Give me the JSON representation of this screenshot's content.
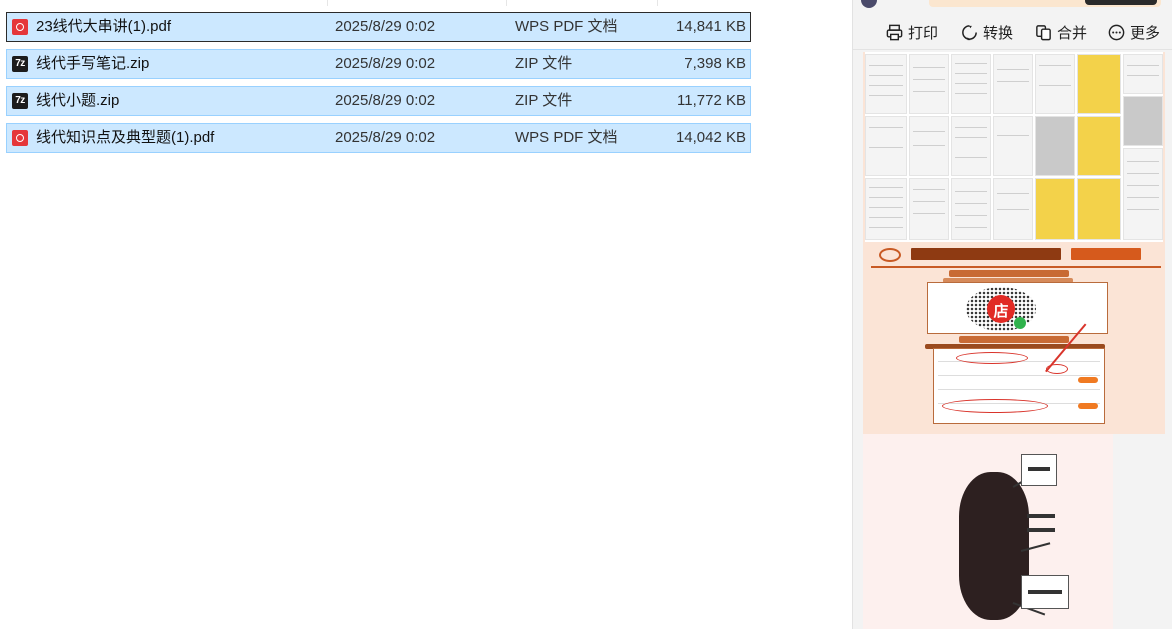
{
  "files": [
    {
      "name": "23线代大串讲(1).pdf",
      "date": "2025/8/29 0:02",
      "type": "WPS PDF 文档",
      "size": "14,841 KB",
      "icon": "pdf-file-icon",
      "focused": true
    },
    {
      "name": "线代手写笔记.zip",
      "date": "2025/8/29 0:02",
      "type": "ZIP 文件",
      "size": "7,398 KB",
      "icon": "7z-archive-icon",
      "focused": false
    },
    {
      "name": "线代小题.zip",
      "date": "2025/8/29 0:02",
      "type": "ZIP 文件",
      "size": "11,772 KB",
      "icon": "7z-archive-icon",
      "focused": false
    },
    {
      "name": "线代知识点及典型题(1).pdf",
      "date": "2025/8/29 0:02",
      "type": "WPS PDF 文档",
      "size": "14,042 KB",
      "icon": "pdf-file-icon",
      "focused": false
    }
  ],
  "zip_icon_text": "7z",
  "preview": {
    "toolbar": {
      "print": "打印",
      "convert": "转换",
      "merge": "合并",
      "more": "更多"
    },
    "qr_badge": "店"
  },
  "colors": {
    "selection_bg": "#cce8ff",
    "selection_border": "#99d1ff",
    "pdf_icon": "#e5363a",
    "preview_ad_bg": "#fbe4d6"
  }
}
